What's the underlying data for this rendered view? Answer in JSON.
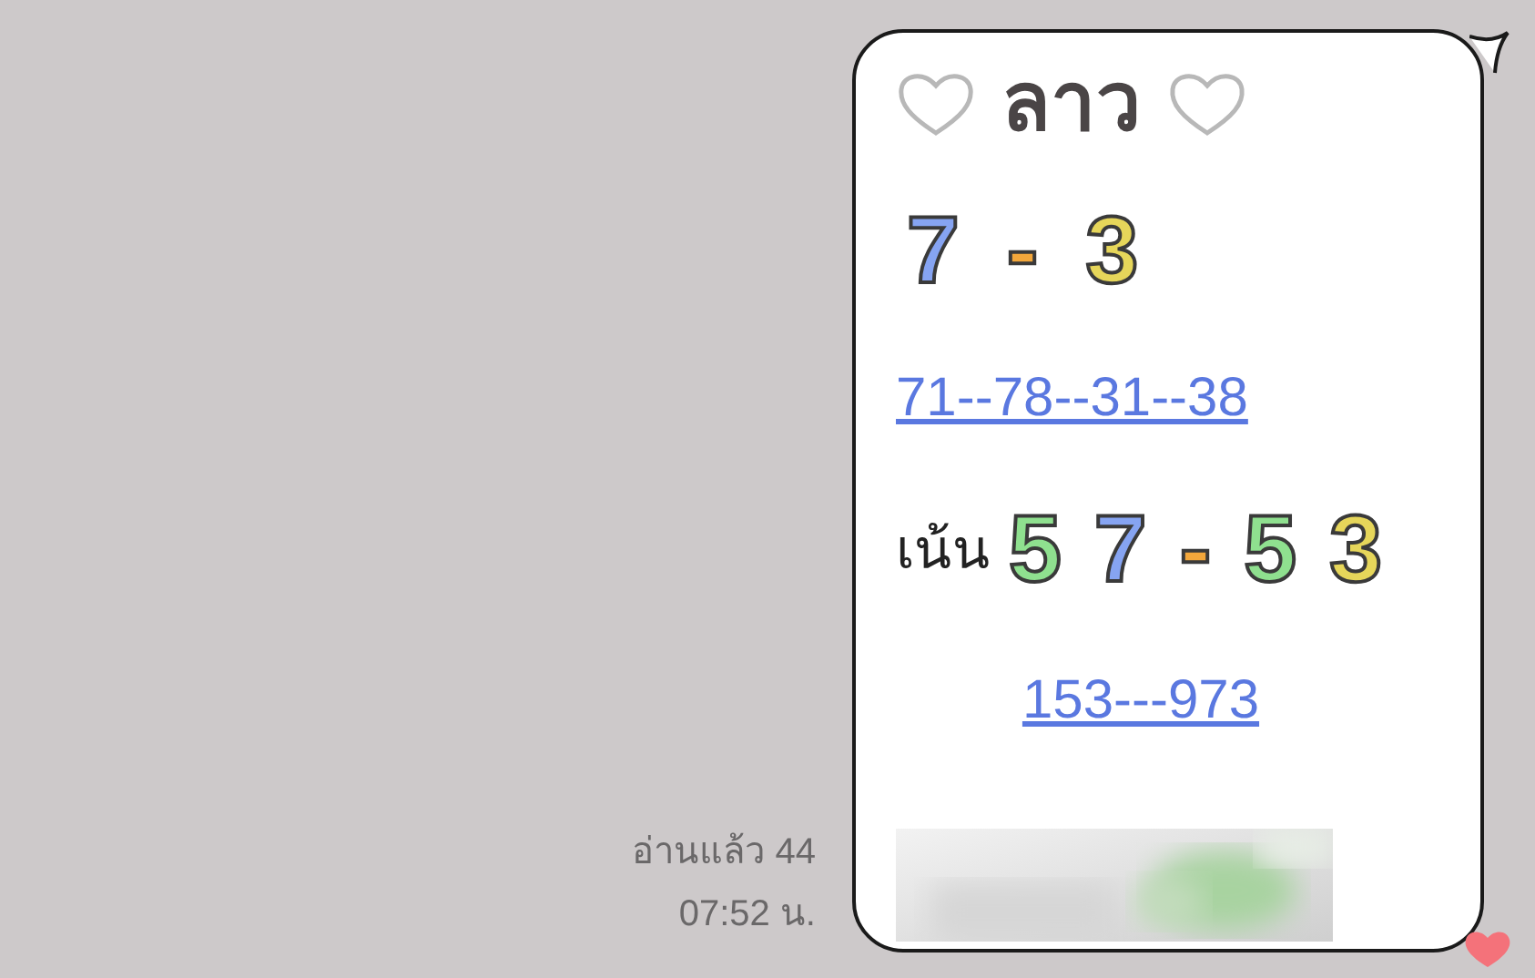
{
  "message": {
    "lines": [
      {
        "kind": "title",
        "text": "ลาว"
      },
      {
        "kind": "emoji_digits",
        "tokens": [
          {
            "text": "7",
            "color": "#86a4f2"
          },
          {
            "text": "-",
            "color": "#f3a73b"
          },
          {
            "text": "3",
            "color": "#e6d65a"
          }
        ]
      },
      {
        "kind": "link",
        "text": "71--78--31--38"
      },
      {
        "kind": "emphasis",
        "label": "เน้น",
        "tokens": [
          {
            "text": "5",
            "color": "#8fe08f"
          },
          {
            "text": "7",
            "color": "#86a4f2"
          },
          {
            "text": "-",
            "color": "#f3a73b"
          },
          {
            "text": "5",
            "color": "#8fe08f"
          },
          {
            "text": "3",
            "color": "#e6d65a"
          }
        ]
      },
      {
        "kind": "link_center",
        "text": "153---973"
      }
    ]
  },
  "read_receipt": "อ่านแล้ว 44",
  "time": "07:52 น."
}
